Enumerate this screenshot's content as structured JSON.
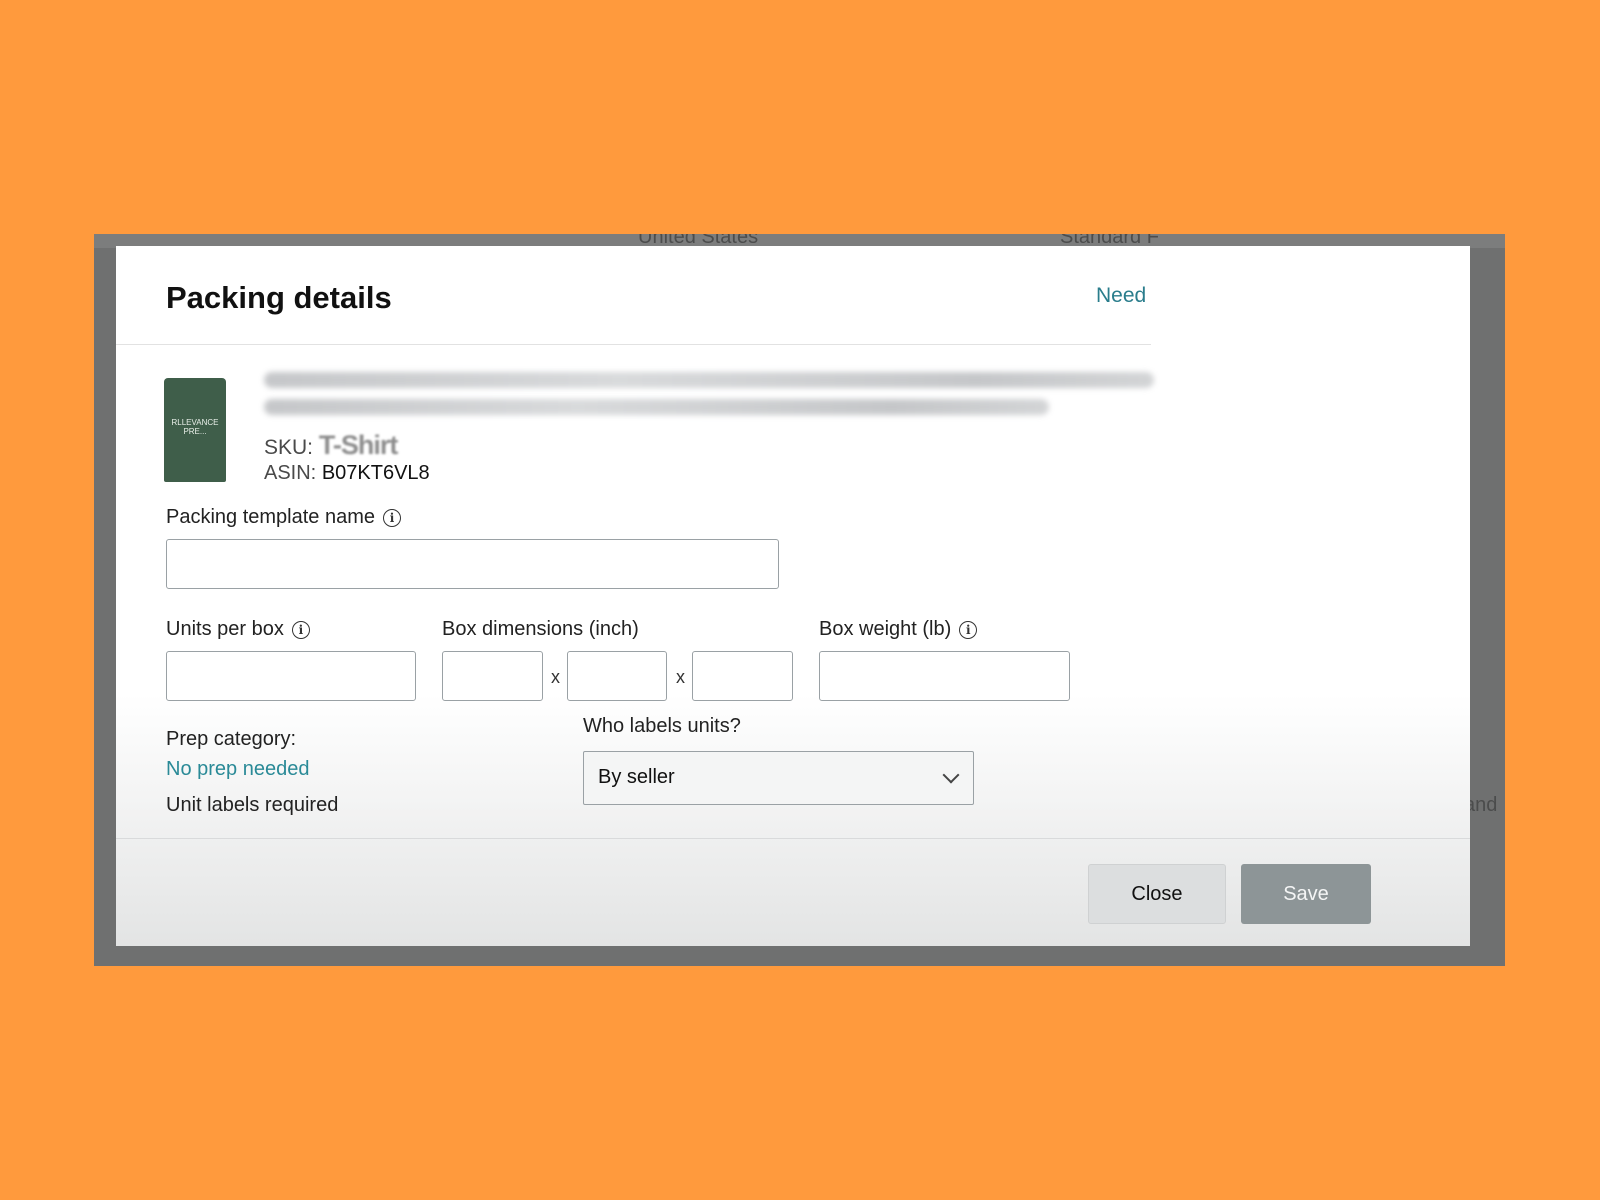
{
  "background_page": {
    "dropdown_country": "United States",
    "dropdown_shipping": "Standard F",
    "right_fragment": "and"
  },
  "modal": {
    "title": "Packing details",
    "help_link": "Need",
    "product": {
      "thumbnail_brand": "RLLEVANCE PRE...",
      "sku_label": "SKU:",
      "sku_value": "T-Shirt",
      "asin_label": "ASIN:",
      "asin_value": "B07KT6VL8"
    },
    "fields": {
      "template_name_label": "Packing template name",
      "template_name_value": "",
      "units_per_box_label": "Units per box",
      "units_per_box_value": "",
      "box_dimensions_label": "Box dimensions (inch)",
      "dimension_separator": "x",
      "box_weight_label": "Box weight (lb)",
      "box_weight_value": ""
    },
    "prep": {
      "category_label": "Prep category:",
      "category_value": "No prep needed",
      "unit_labels_note": "Unit labels required"
    },
    "labeling": {
      "who_label": "Who labels units?",
      "selected": "By seller"
    },
    "buttons": {
      "close": "Close",
      "save": "Save"
    }
  },
  "icons": {
    "info": "info-circle-icon",
    "dropdown": "chevron-down-icon"
  },
  "colors": {
    "page_background": "#ff9a3d",
    "link": "#2a7d8c",
    "save_button": "#8d9597",
    "overlay": "#6f7070"
  }
}
